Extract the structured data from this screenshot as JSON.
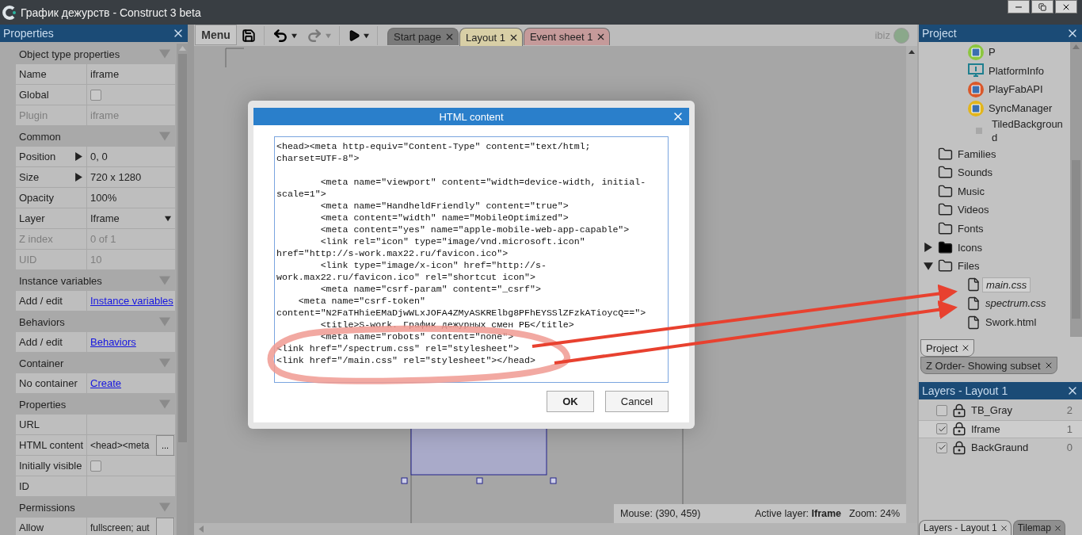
{
  "window": {
    "title": "График дежурств - Construct 3 beta"
  },
  "properties": {
    "title": "Properties",
    "sections": [
      {
        "title": "Object type properties",
        "expanded": true,
        "rows": [
          {
            "label": "Name",
            "value": "iframe",
            "kind": "text",
            "disabled": false
          },
          {
            "label": "Global",
            "kind": "checkbox",
            "checked": false,
            "disabled": false
          },
          {
            "label": "Plugin",
            "value": "iframe",
            "kind": "text",
            "disabled": true
          }
        ]
      },
      {
        "title": "Common",
        "expanded": true,
        "rows": [
          {
            "label": "Position",
            "value": "0, 0",
            "kind": "expandable",
            "disabled": false
          },
          {
            "label": "Size",
            "value": "720 x 1280",
            "kind": "expandable",
            "disabled": false
          },
          {
            "label": "Opacity",
            "value": "100%",
            "kind": "text",
            "disabled": false
          },
          {
            "label": "Layer",
            "value": "Iframe",
            "kind": "dropdown",
            "disabled": false
          },
          {
            "label": "Z index",
            "value": "0 of 1",
            "kind": "text",
            "disabled": true
          },
          {
            "label": "UID",
            "value": "10",
            "kind": "text",
            "disabled": true
          }
        ]
      },
      {
        "title": "Instance variables",
        "expanded": true,
        "rows": [
          {
            "label": "Add / edit",
            "value": "Instance variables",
            "kind": "link",
            "disabled": false
          }
        ]
      },
      {
        "title": "Behaviors",
        "expanded": true,
        "rows": [
          {
            "label": "Add / edit",
            "value": "Behaviors",
            "kind": "link",
            "disabled": false
          }
        ]
      },
      {
        "title": "Container",
        "expanded": true,
        "rows": [
          {
            "label": "No container",
            "value": "Create",
            "kind": "link",
            "disabled": false
          }
        ]
      },
      {
        "title": "Properties",
        "expanded": true,
        "rows": [
          {
            "label": "URL",
            "kind": "text",
            "disabled": false
          },
          {
            "label": "HTML content",
            "value": "<head><meta",
            "kind": "button",
            "button": "...",
            "disabled": false
          },
          {
            "label": "Initially visible",
            "kind": "checkbox",
            "checked": false,
            "disabled": false
          },
          {
            "label": "ID",
            "kind": "text",
            "disabled": false
          }
        ]
      },
      {
        "title": "Permissions",
        "expanded": true,
        "rows": [
          {
            "label": "Allow",
            "value": "fullscreen; aut",
            "kind": "button",
            "disabled": false
          }
        ]
      }
    ]
  },
  "toolbar": {
    "menu": "Menu",
    "undo_enabled": true,
    "redo_enabled": false
  },
  "tabs": [
    {
      "label": "Start page",
      "selected": false,
      "color": "#7a7a7a"
    },
    {
      "label": "Layout 1",
      "selected": true,
      "color": "#d8cfa6"
    },
    {
      "label": "Event sheet 1",
      "selected": false,
      "color": "#c59a9a"
    }
  ],
  "user": "ibiz",
  "dialog": {
    "title": "HTML content",
    "content": "<head><meta http-equiv=\"Content-Type\" content=\"text/html;\ncharset=UTF-8\">\n\n        <meta name=\"viewport\" content=\"width=device-width, initial-\nscale=1\">\n        <meta name=\"HandheldFriendly\" content=\"true\">\n        <meta content=\"width\" name=\"MobileOptimized\">\n        <meta content=\"yes\" name=\"apple-mobile-web-app-capable\">\n        <link rel=\"icon\" type=\"image/vnd.microsoft.icon\"\nhref=\"http://s-work.max22.ru/favicon.ico\">\n        <link type=\"image/x-icon\" href=\"http://s-\nwork.max22.ru/favicon.ico\" rel=\"shortcut icon\">\n        <meta name=\"csrf-param\" content=\"_csrf\">\n    <meta name=\"csrf-token\"\ncontent=\"N2FaTHhieEMaDjwWLxJOFA4ZMyASKRElbg8PFhEYSSlZFzkATioycQ==\">\n        <title>S-work. График дежурных смен РБ</title>\n        <meta name=\"robots\" content=\"none\">\n<link href=\"/spectrum.css\" rel=\"stylesheet\">\n<link href=\"/main.css\" rel=\"stylesheet\"></head>",
    "buttons": [
      {
        "label": "OK",
        "kind": "primary"
      },
      {
        "label": "Cancel",
        "kind": "secondary"
      }
    ]
  },
  "status_bar": {
    "mouse": "Mouse: (390, 459)",
    "layer": "Active layer: **Iframe**",
    "zoom": "Zoom: 24%"
  },
  "project": {
    "title": "Project",
    "items": [
      {
        "label": "P",
        "kind": "object",
        "color": "#8cc63f"
      },
      {
        "label": "PlatformInfo",
        "kind": "monitor",
        "color": "#1f7f8f"
      },
      {
        "label": "PlayFabAPI",
        "kind": "object",
        "color": "#d9582b"
      },
      {
        "label": "SyncManager",
        "kind": "object",
        "color": "#e2b51c"
      },
      {
        "label": "TiledBackground",
        "kind": "tile",
        "color": "#a8a8a8"
      },
      {
        "label": "Families",
        "kind": "folder"
      },
      {
        "label": "Sounds",
        "kind": "folder"
      },
      {
        "label": "Music",
        "kind": "folder"
      },
      {
        "label": "Videos",
        "kind": "folder"
      },
      {
        "label": "Fonts",
        "kind": "folder"
      },
      {
        "label": "Icons",
        "kind": "folder",
        "expanded": false
      },
      {
        "label": "Files",
        "kind": "folder",
        "expanded": true,
        "children": [
          {
            "label": "main.css",
            "kind": "file",
            "selected": true,
            "emphasized": true
          },
          {
            "label": "spectrum.css",
            "kind": "file",
            "selected": false,
            "emphasized": true
          },
          {
            "label": "Swork.html",
            "kind": "file",
            "selected": false,
            "emphasized": false
          }
        ]
      }
    ],
    "tabs": [
      {
        "label": "Project",
        "selected": true
      },
      {
        "label": "Z Order- Showing subset",
        "selected": false
      }
    ]
  },
  "layers": {
    "title": "Layers - Layout 1",
    "rows": [
      {
        "name": "TB_Gray",
        "visible": false,
        "index": "2",
        "selected": false
      },
      {
        "name": "Iframe",
        "visible": true,
        "index": "1",
        "selected": true
      },
      {
        "name": "BackGraund",
        "visible": true,
        "index": "0",
        "selected": false
      }
    ],
    "tabs": [
      {
        "label": "Layers - Layout 1",
        "selected": true
      },
      {
        "label": "Tilemap",
        "selected": false
      }
    ]
  }
}
